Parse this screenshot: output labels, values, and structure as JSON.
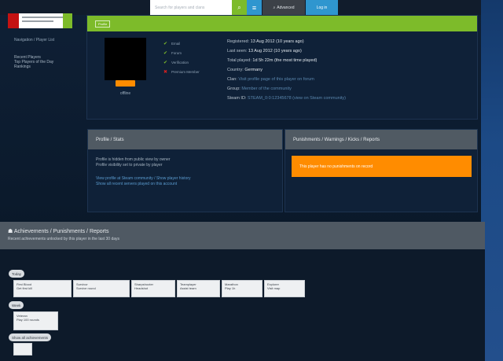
{
  "header": {
    "search_placeholder": "Search for players and clans",
    "search_icon": "search-icon",
    "menu_icon": "menu-icon",
    "advanced_label": "Advanced",
    "advanced_icon": "search-icon",
    "login_label": "Log in"
  },
  "sidebar": {
    "title": "Navigation / Player List",
    "items": [
      "Recent Players",
      "Top Players of the Day",
      "Rankings"
    ]
  },
  "profile": {
    "tag": "Profile",
    "avatar_caption": "offline",
    "status": [
      {
        "label": "Email",
        "ok": true
      },
      {
        "label": "Forum",
        "ok": true
      },
      {
        "label": "Verification",
        "ok": true
      },
      {
        "label": "Premium Member",
        "ok": false
      }
    ],
    "info": [
      {
        "label": "Registered:",
        "value": "13 Aug 2012 (10 years ago)"
      },
      {
        "label": "Last seen:",
        "value": "13 Aug 2012 (10 years ago)"
      },
      {
        "label": "Total played:",
        "value": "1d 5h 22m (the most time played)"
      },
      {
        "label": "Country:",
        "value": "Germany"
      },
      {
        "label": "Clan:",
        "value": "Visit profile page of this player on forum"
      },
      {
        "label": "Group:",
        "value": "Member of the community"
      },
      {
        "label": "Steam ID:",
        "value": "STEAM_0:0:12345678 (view on Steam community)"
      }
    ]
  },
  "profile_block": {
    "title": "Profile / Stats",
    "lines": [
      "Profile is hidden from public view by owner",
      "Profile visibility set to private by player"
    ],
    "links": [
      "View profile at Steam community / Show player history",
      "Show all recent servers played on this account"
    ]
  },
  "bans_block": {
    "title": "Punishments / Warnings / Kicks / Reports",
    "notice": "This player has no punishments on record"
  },
  "section": {
    "title": "Achievements / Punishments / Reports",
    "subtitle": "Recent achievements unlocked by this player in the last 30 days"
  },
  "pills": [
    "Today",
    "Week",
    "Show all achievements"
  ],
  "thumbs": [
    {
      "name": "First Blood",
      "desc": "Get first kill"
    },
    {
      "name": "Survivor",
      "desc": "Survive round"
    },
    {
      "name": "Sharpshooter",
      "desc": "Headshot"
    },
    {
      "name": "Teamplayer",
      "desc": "Assist team"
    },
    {
      "name": "Marathon",
      "desc": "Play 1h"
    },
    {
      "name": "Explorer",
      "desc": "Visit map"
    },
    {
      "name": "Veteran",
      "desc": "Play 100 rounds"
    }
  ]
}
